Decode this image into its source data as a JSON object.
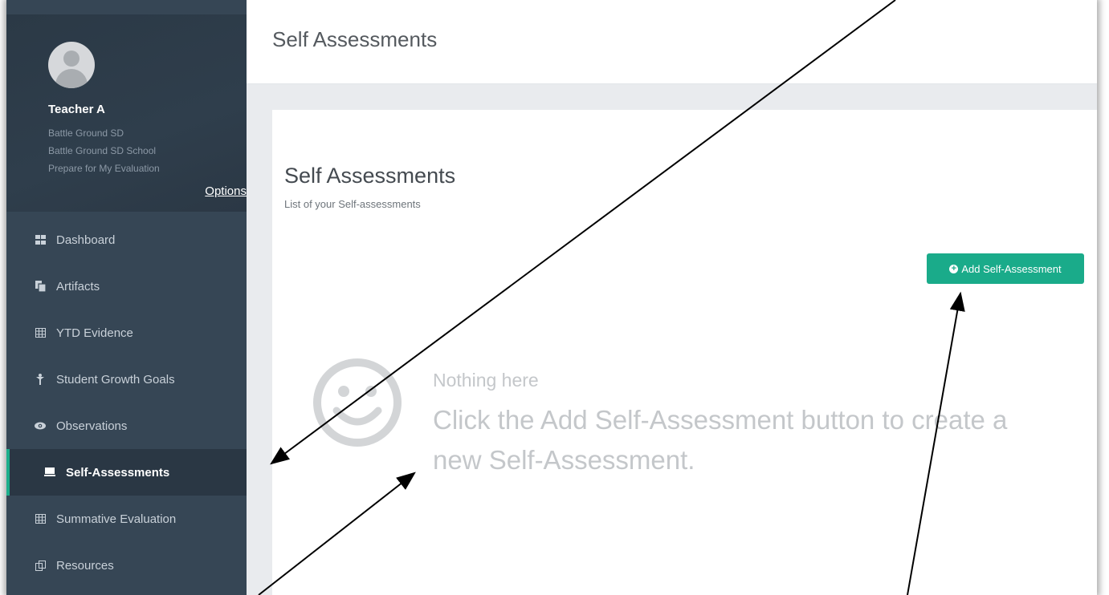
{
  "sidebar": {
    "profile": {
      "name": "Teacher A",
      "district": "Battle Ground SD",
      "school": "Battle Ground SD School",
      "role": "Prepare for My Evaluation",
      "options_label": "Options"
    },
    "items": [
      {
        "label": "Dashboard",
        "icon": "dashboard-icon"
      },
      {
        "label": "Artifacts",
        "icon": "artifacts-icon"
      },
      {
        "label": "YTD Evidence",
        "icon": "table-icon"
      },
      {
        "label": "Student Growth Goals",
        "icon": "growth-icon"
      },
      {
        "label": "Observations",
        "icon": "eye-icon"
      },
      {
        "label": "Self-Assessments",
        "icon": "self-assessment-icon",
        "active": true
      },
      {
        "label": "Summative Evaluation",
        "icon": "table-icon"
      },
      {
        "label": "Resources",
        "icon": "resources-icon"
      }
    ]
  },
  "header": {
    "title": "Self Assessments"
  },
  "main": {
    "title": "Self Assessments",
    "subtitle": "List of your Self-assessments",
    "add_button_label": "Add Self-Assessment",
    "empty_state": {
      "icon": "smiley-icon",
      "heading": "Nothing here",
      "message": "Click the Add Self-Assessment button to create a new Self-Assessment."
    }
  },
  "colors": {
    "sidebar_bg": "#364655",
    "accent": "#1aab8a",
    "muted_text": "#c4c7ca"
  }
}
